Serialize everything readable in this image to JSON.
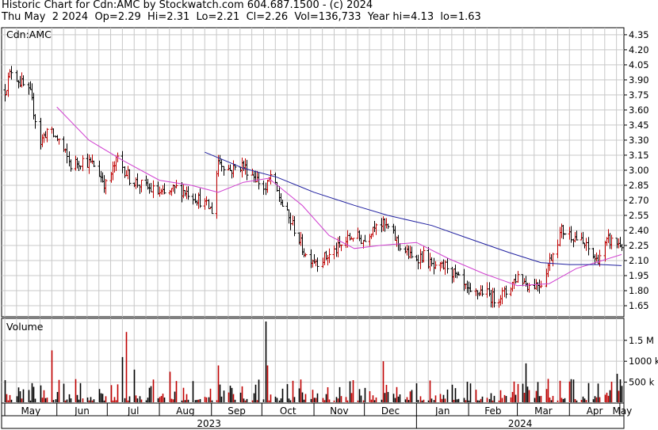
{
  "header": {
    "title": "Historic Chart for Cdn:AMC by Stockwatch.com 604.687.1500 - (c) 2024",
    "quote": "Thu May  2 2024  Op=2.29  Hi=2.31  Lo=2.21  Cl=2.26  Vol=136,733  Year hi=4.13  lo=1.63"
  },
  "chart_data": {
    "type": "ohlc",
    "symbol_label": "Cdn:AMC",
    "volume_label": "Volume",
    "price_ticks": [
      "4.35",
      "4.20",
      "4.05",
      "3.90",
      "3.75",
      "3.60",
      "3.45",
      "3.30",
      "3.15",
      "3.00",
      "2.85",
      "2.70",
      "2.55",
      "2.40",
      "2.25",
      "2.10",
      "1.95",
      "1.80",
      "1.65"
    ],
    "price_range": [
      1.54,
      4.42
    ],
    "volume_ticks": [
      "1.5 M",
      "1000 k",
      "500 k"
    ],
    "volume_range": [
      0,
      1950000
    ],
    "month_labels": [
      "May",
      "Jun",
      "Jul",
      "Aug",
      "Sep",
      "Oct",
      "Nov",
      "Dec",
      "Jan",
      "Feb",
      "Mar",
      "Apr",
      "May"
    ],
    "year_labels": [
      "2023",
      "2024"
    ],
    "period_start": "2023-05-01",
    "period_end": "2024-05-02",
    "price_path": [
      {
        "date": "2023-05-01",
        "close": 3.8
      },
      {
        "date": "2023-05-05",
        "close": 4.0
      },
      {
        "date": "2023-05-10",
        "close": 3.88
      },
      {
        "date": "2023-05-16",
        "close": 3.75
      },
      {
        "date": "2023-05-22",
        "close": 3.28
      },
      {
        "date": "2023-05-26",
        "close": 3.4
      },
      {
        "date": "2023-06-02",
        "close": 3.3
      },
      {
        "date": "2023-06-09",
        "close": 3.05
      },
      {
        "date": "2023-06-16",
        "close": 3.1
      },
      {
        "date": "2023-06-23",
        "close": 3.05
      },
      {
        "date": "2023-06-30",
        "close": 2.85
      },
      {
        "date": "2023-07-07",
        "close": 3.12
      },
      {
        "date": "2023-07-14",
        "close": 2.92
      },
      {
        "date": "2023-07-21",
        "close": 2.85
      },
      {
        "date": "2023-07-28",
        "close": 2.8
      },
      {
        "date": "2023-08-04",
        "close": 2.75
      },
      {
        "date": "2023-08-11",
        "close": 2.82
      },
      {
        "date": "2023-08-18",
        "close": 2.78
      },
      {
        "date": "2023-08-25",
        "close": 2.7
      },
      {
        "date": "2023-09-01",
        "close": 2.6
      },
      {
        "date": "2023-09-05",
        "close": 3.1
      },
      {
        "date": "2023-09-12",
        "close": 3.0
      },
      {
        "date": "2023-09-19",
        "close": 3.05
      },
      {
        "date": "2023-09-26",
        "close": 2.95
      },
      {
        "date": "2023-10-03",
        "close": 2.8
      },
      {
        "date": "2023-10-06",
        "close": 2.95
      },
      {
        "date": "2023-10-13",
        "close": 2.65
      },
      {
        "date": "2023-10-20",
        "close": 2.42
      },
      {
        "date": "2023-10-27",
        "close": 2.15
      },
      {
        "date": "2023-11-03",
        "close": 2.1
      },
      {
        "date": "2023-11-10",
        "close": 2.15
      },
      {
        "date": "2023-11-17",
        "close": 2.25
      },
      {
        "date": "2023-11-24",
        "close": 2.35
      },
      {
        "date": "2023-12-01",
        "close": 2.3
      },
      {
        "date": "2023-12-08",
        "close": 2.5
      },
      {
        "date": "2023-12-15",
        "close": 2.42
      },
      {
        "date": "2023-12-22",
        "close": 2.25
      },
      {
        "date": "2023-12-29",
        "close": 2.12
      },
      {
        "date": "2024-01-05",
        "close": 2.15
      },
      {
        "date": "2024-01-12",
        "close": 2.0
      },
      {
        "date": "2024-01-19",
        "close": 2.05
      },
      {
        "date": "2024-01-26",
        "close": 1.9
      },
      {
        "date": "2024-02-02",
        "close": 1.75
      },
      {
        "date": "2024-02-09",
        "close": 1.8
      },
      {
        "date": "2024-02-16",
        "close": 1.72
      },
      {
        "date": "2024-02-23",
        "close": 1.78
      },
      {
        "date": "2024-03-01",
        "close": 1.95
      },
      {
        "date": "2024-03-08",
        "close": 1.85
      },
      {
        "date": "2024-03-15",
        "close": 1.88
      },
      {
        "date": "2024-03-20",
        "close": 2.1
      },
      {
        "date": "2024-03-27",
        "close": 2.4
      },
      {
        "date": "2024-04-03",
        "close": 2.35
      },
      {
        "date": "2024-04-10",
        "close": 2.25
      },
      {
        "date": "2024-04-17",
        "close": 2.1
      },
      {
        "date": "2024-04-24",
        "close": 2.3
      },
      {
        "date": "2024-05-02",
        "close": 2.26
      }
    ],
    "moving_average_short": [
      {
        "date": "2023-06-01",
        "value": 3.63
      },
      {
        "date": "2023-06-20",
        "value": 3.3
      },
      {
        "date": "2023-07-10",
        "value": 3.1
      },
      {
        "date": "2023-08-01",
        "value": 2.9
      },
      {
        "date": "2023-08-20",
        "value": 2.85
      },
      {
        "date": "2023-09-05",
        "value": 2.78
      },
      {
        "date": "2023-09-20",
        "value": 2.88
      },
      {
        "date": "2023-10-05",
        "value": 2.92
      },
      {
        "date": "2023-10-25",
        "value": 2.65
      },
      {
        "date": "2023-11-10",
        "value": 2.35
      },
      {
        "date": "2023-11-25",
        "value": 2.22
      },
      {
        "date": "2023-12-10",
        "value": 2.25
      },
      {
        "date": "2024-01-01",
        "value": 2.28
      },
      {
        "date": "2024-01-20",
        "value": 2.12
      },
      {
        "date": "2024-02-10",
        "value": 1.97
      },
      {
        "date": "2024-03-01",
        "value": 1.85
      },
      {
        "date": "2024-03-20",
        "value": 1.87
      },
      {
        "date": "2024-04-05",
        "value": 2.02
      },
      {
        "date": "2024-05-02",
        "value": 2.16
      }
    ],
    "moving_average_long": [
      {
        "date": "2023-08-28",
        "value": 3.18
      },
      {
        "date": "2023-09-20",
        "value": 3.02
      },
      {
        "date": "2023-10-10",
        "value": 2.93
      },
      {
        "date": "2023-11-01",
        "value": 2.78
      },
      {
        "date": "2023-11-25",
        "value": 2.65
      },
      {
        "date": "2023-12-15",
        "value": 2.55
      },
      {
        "date": "2024-01-10",
        "value": 2.45
      },
      {
        "date": "2024-02-01",
        "value": 2.32
      },
      {
        "date": "2024-02-25",
        "value": 2.18
      },
      {
        "date": "2024-03-15",
        "value": 2.08
      },
      {
        "date": "2024-04-01",
        "value": 2.06
      },
      {
        "date": "2024-04-20",
        "value": 2.06
      },
      {
        "date": "2024-05-02",
        "value": 2.05
      }
    ],
    "volume_spikes": [
      {
        "date": "2023-05-29",
        "volume": 1260000
      },
      {
        "date": "2023-07-10",
        "volume": 1100000
      },
      {
        "date": "2023-07-12",
        "volume": 1700000
      },
      {
        "date": "2023-07-17",
        "volume": 800000
      },
      {
        "date": "2023-08-07",
        "volume": 750000
      },
      {
        "date": "2023-09-05",
        "volume": 900000
      },
      {
        "date": "2023-10-03",
        "volume": 1950000
      },
      {
        "date": "2023-10-04",
        "volume": 900000
      },
      {
        "date": "2023-12-12",
        "volume": 1000000
      },
      {
        "date": "2024-03-06",
        "volume": 950000
      },
      {
        "date": "2024-04-29",
        "volume": 700000
      }
    ],
    "colors": {
      "up": "#c00000",
      "down": "#000000",
      "ma_short": "#d040d0",
      "ma_long": "#2020a0",
      "grid": "#c8c8c8"
    }
  }
}
